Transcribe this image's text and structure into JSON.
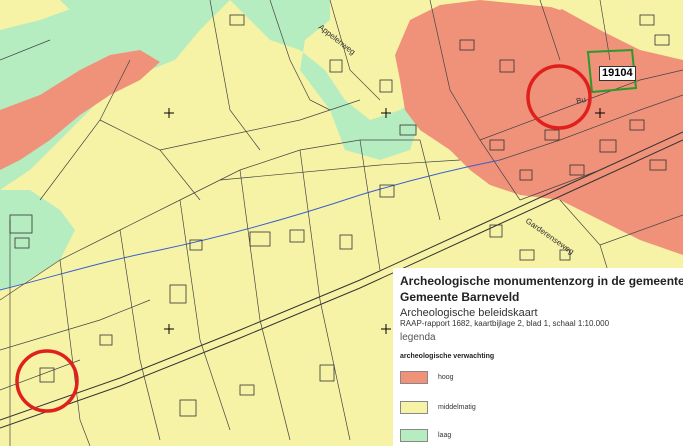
{
  "map": {
    "parcel_label": "19104",
    "street_labels": [
      "Appelenweg",
      "Bu",
      "Garderenseweg"
    ]
  },
  "legend": {
    "title_line1": "Archeologische monumentenzorg in de gemeente Barneveld",
    "title_line2": "Gemeente Barneveld",
    "subtitle": "Archeologische beleidskaart",
    "reference": "RAAP-rapport 1682, kaartbijlage 2, blad 1, schaal 1:10.000",
    "heading": "legenda",
    "category": "archeologische verwachting",
    "items": [
      {
        "label": "hoog",
        "color": "#f0917a"
      },
      {
        "label": "middelmatig",
        "color": "#f7f3a6"
      },
      {
        "label": "laag",
        "color": "#b6edc0"
      }
    ]
  },
  "colors": {
    "high": "#f0917a",
    "medium": "#f7f3a6",
    "low": "#b6edc0",
    "highlight_circle": "#e0201c",
    "parcel_outline": "#2a9a2a",
    "water_line": "#3a5fd0"
  }
}
